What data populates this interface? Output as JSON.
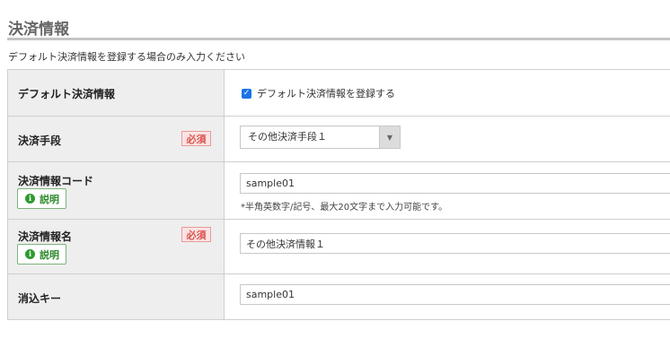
{
  "section": {
    "title": "決済情報",
    "description": "デフォルト決済情報を登録する場合のみ入力ください"
  },
  "required_label": "必須",
  "help_label": "説明",
  "info_icon_glyph": "i",
  "rows": {
    "default_payment": {
      "label": "デフォルト決済情報",
      "checkbox_label": "デフォルト決済情報を登録する",
      "checked": true
    },
    "payment_method": {
      "label": "決済手段",
      "selected": "その他決済手段１"
    },
    "payment_code": {
      "label": "決済情報コード",
      "value": "sample01",
      "note": "*半角英数字/記号、最大20文字まで入力可能です。"
    },
    "payment_name": {
      "label": "決済情報名",
      "value": "その他決済情報１"
    },
    "delete_key": {
      "label": "消込キー",
      "value": "sample01"
    }
  },
  "colors": {
    "accent": "#1a73e8",
    "required": "#d9534f",
    "help": "#2e8b2e",
    "header_bg": "#eeeeee"
  }
}
